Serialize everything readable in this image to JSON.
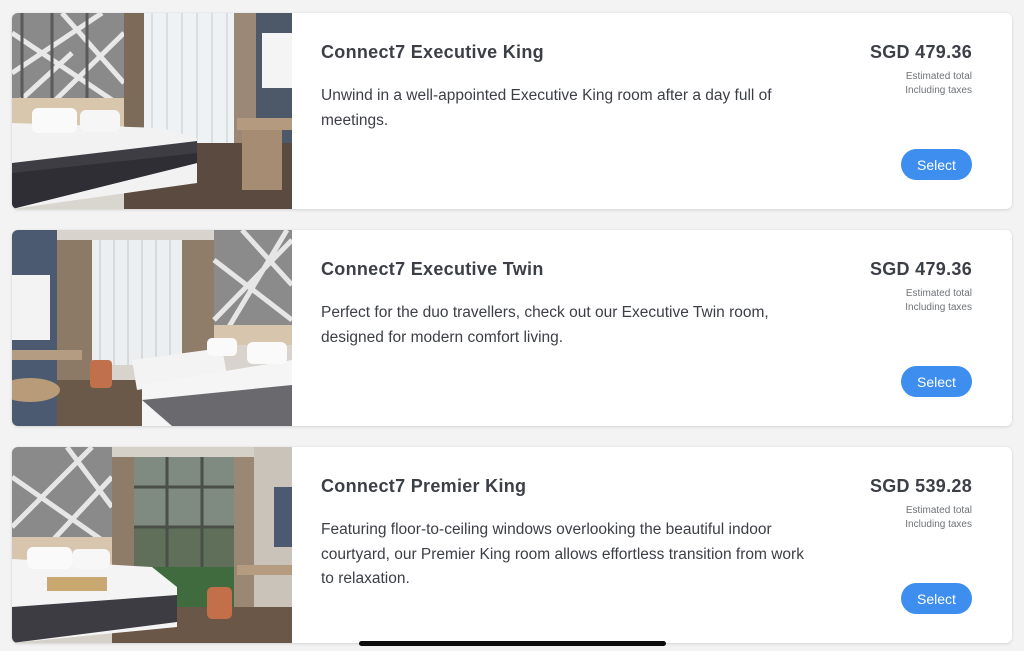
{
  "rooms": [
    {
      "name": "Connect7 Executive King",
      "description": "Unwind in a well-appointed Executive King room after a day full of meetings.",
      "price": "SGD 479.36",
      "price_note_1": "Estimated total",
      "price_note_2": "Including taxes",
      "select_label": "Select",
      "photo_label": "Connect7 Executive King room photo"
    },
    {
      "name": "Connect7 Executive Twin",
      "description": "Perfect for the duo travellers, check out our Executive Twin room, designed for modern comfort living.",
      "price": "SGD 479.36",
      "price_note_1": "Estimated total",
      "price_note_2": "Including taxes",
      "select_label": "Select",
      "photo_label": "Connect7 Executive Twin room photo"
    },
    {
      "name": "Connect7 Premier King",
      "description": "Featuring floor-to-ceiling windows overlooking the beautiful indoor courtyard, our Premier King room allows effortless transition from work to relaxation.",
      "price": "SGD 539.28",
      "price_note_1": "Estimated total",
      "price_note_2": "Including taxes",
      "select_label": "Select",
      "photo_label": "Connect7 Premier King room photo"
    }
  ],
  "colors": {
    "accent": "#3d8eef",
    "text": "#3c3f45",
    "muted": "#6f7378",
    "background": "#f3f3f4"
  }
}
